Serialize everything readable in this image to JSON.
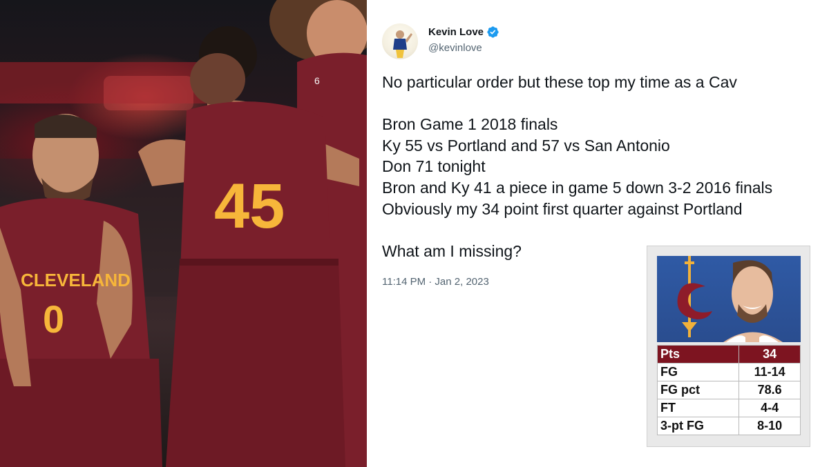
{
  "photo": {
    "jersey_left_team": "CLEVELAND",
    "jersey_left_number": "0",
    "jersey_center_number": "45",
    "colors": {
      "wine": "#7a1f2b",
      "gold": "#f7b63a"
    }
  },
  "tweet": {
    "author_name": "Kevin Love",
    "author_handle": "@kevinlove",
    "verified": true,
    "lines": [
      "No particular order but these top my time as a Cav",
      "",
      "Bron Game 1 2018 finals",
      "Ky 55 vs Portland and 57 vs San Antonio",
      "Don 71 tonight",
      "Bron and Ky 41 a piece in game 5 down 3-2 2016 finals",
      "Obviously my 34 point first quarter against Portland",
      "",
      "What am I missing?"
    ],
    "timestamp": "11:14 PM · Jan 2, 2023",
    "colors": {
      "text": "#0f1419",
      "secondary": "#536471",
      "verified": "#1d9bf0"
    }
  },
  "stat_card": {
    "header": {
      "label": "Pts",
      "value": "34"
    },
    "rows": [
      {
        "label": "FG",
        "value": "11-14"
      },
      {
        "label": "FG pct",
        "value": "78.6"
      },
      {
        "label": "FT",
        "value": "4-4"
      },
      {
        "label": "3-pt FG",
        "value": "8-10"
      }
    ],
    "colors": {
      "header": "#7d1420",
      "background": "#2f5aa5"
    }
  }
}
